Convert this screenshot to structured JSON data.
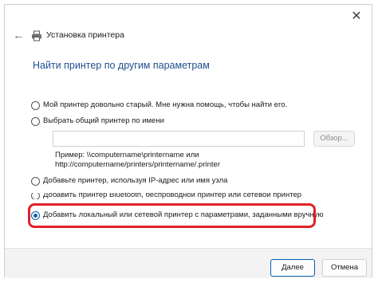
{
  "window": {
    "close_glyph": "✕",
    "back_glyph": "←",
    "title": "Установка принтера"
  },
  "heading": "Найти принтер по другим параметрам",
  "options": [
    {
      "label": "Мой принтер довольно старый. Мне нужна помощь, чтобы найти его.",
      "checked": false
    },
    {
      "label": "Выбрать общий принтер по имени",
      "checked": false
    },
    {
      "label": "Добавьте принтер, используя IP-адрес или имя узла",
      "checked": false
    },
    {
      "label": "Добавить принтер Bluetooth, беспроводной принтер или сетевой принтер",
      "checked": false
    },
    {
      "label": "Добавить локальный или сетевой принтер с параметрами, заданными вручную",
      "checked": true
    }
  ],
  "share_input": {
    "value": ""
  },
  "browse_label": "Обзор...",
  "example_lines": [
    "Пример: \\\\computername\\printername или",
    "http://computername/printers/printername/.printer"
  ],
  "buttons": {
    "next": "Далее",
    "cancel": "Отмена"
  },
  "colors": {
    "heading": "#1f4f8f",
    "accent": "#0b5cad",
    "highlight": "#e0222a"
  },
  "icons": [
    "close-icon",
    "back-arrow-icon",
    "printer-icon"
  ]
}
